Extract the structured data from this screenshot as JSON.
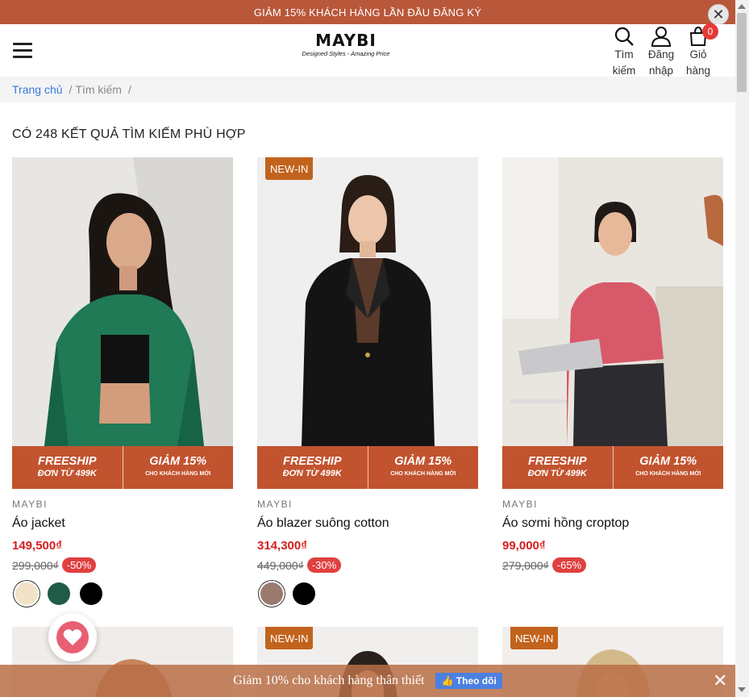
{
  "topbar": {
    "promo": "GIẢM 15% KHÁCH HÀNG LẦN ĐẦU ĐĂNG KÝ",
    "close": "✕"
  },
  "header": {
    "logo": "MAYBI",
    "tagline": "Designed Styles - Amazing Price",
    "search_label": "Tìm",
    "search_label2": "kiếm",
    "login_label": "Đăng",
    "login_label2": "nhập",
    "cart_label": "Giỏ",
    "cart_label2": "hàng",
    "cart_count": "0"
  },
  "breadcrumb": {
    "home": "Trang chủ",
    "sep1": "/",
    "current": "Tìm kiếm",
    "sep2": "/"
  },
  "results": {
    "title": "CÓ 248 KẾT QUẢ TÌM KIẾM PHÙ HỢP"
  },
  "promo_banner": {
    "freeship": "FREESHIP",
    "from": "ĐƠN TỪ 499K",
    "discount": "GIẢM 15%",
    "for": "CHO KHÁCH HÀNG MỚI"
  },
  "products": [
    {
      "brand": "MAYBI",
      "name": "Áo jacket",
      "price": "149,500₫",
      "old_price": "299,000₫",
      "discount": "-50%",
      "new_tag": "",
      "colors": [
        "#f2e2c8",
        "#1f5c48",
        "#000000"
      ]
    },
    {
      "brand": "MAYBI",
      "name": "Áo blazer suông cotton",
      "price": "314,300₫",
      "old_price": "449,000₫",
      "discount": "-30%",
      "new_tag": "NEW-IN",
      "colors": [
        "#9b7a6e",
        "#000000"
      ]
    },
    {
      "brand": "MAYBI",
      "name": "Áo sơmi hồng croptop",
      "price": "99,000₫",
      "old_price": "279,000₫",
      "discount": "-65%",
      "new_tag": "",
      "colors": []
    }
  ],
  "next_row": [
    {
      "new_tag": ""
    },
    {
      "new_tag": "NEW-IN"
    },
    {
      "new_tag": "NEW-IN"
    }
  ],
  "bottom_bar": {
    "message": "Giảm 10% cho khách hàng thân thiết",
    "follow": "Theo dõi",
    "close": "✕"
  }
}
